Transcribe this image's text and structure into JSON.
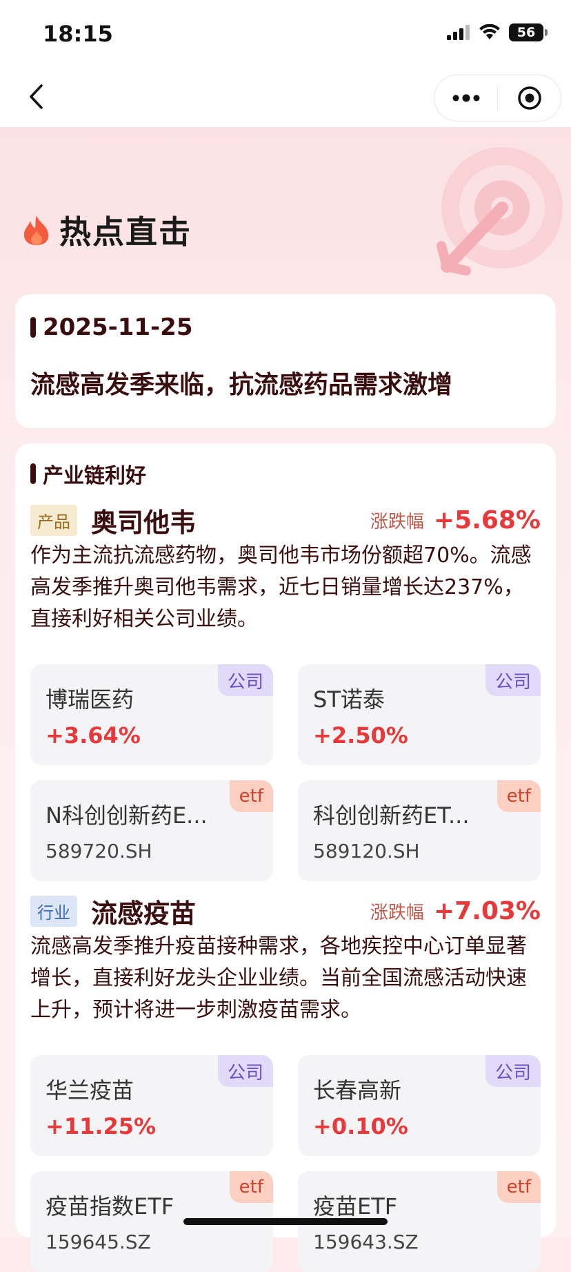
{
  "status": {
    "time": "18:15",
    "battery": "56"
  },
  "nav": {
    "back_icon": "chevron-left-icon",
    "more_icon": "more-dots-icon",
    "close_icon": "target-icon"
  },
  "hero": {
    "title": "热点直击",
    "icon": "flame-icon",
    "deco": "target-arrow-icon"
  },
  "event": {
    "date": "2025-11-25",
    "headline": "流感高发季来临，抗流感药品需求激增"
  },
  "chain": {
    "section_title": "产业链利好",
    "items": [
      {
        "tag": "产品",
        "name": "奥司他韦",
        "change_label": "涨跌幅",
        "change_value": "+5.68%",
        "desc": "作为主流抗流感药物，奥司他韦市场份额超70%。流感高发季推升奥司他韦需求，近七日销量增长达237%，直接利好相关公司业绩。",
        "tiles": [
          {
            "badge": "公司",
            "name": "博瑞医药",
            "value": "+3.64%"
          },
          {
            "badge": "公司",
            "name": "ST诺泰",
            "value": "+2.50%"
          },
          {
            "badge": "etf",
            "name": "N科创创新药E...",
            "code": "589720.SH"
          },
          {
            "badge": "etf",
            "name": "科创创新药ET...",
            "code": "589120.SH"
          }
        ]
      },
      {
        "tag": "行业",
        "name": "流感疫苗",
        "change_label": "涨跌幅",
        "change_value": "+7.03%",
        "desc": "流感高发季推升疫苗接种需求，各地疾控中心订单显著增长，直接利好龙头企业业绩。当前全国流感活动快速上升，预计将进一步刺激疫苗需求。",
        "tiles": [
          {
            "badge": "公司",
            "name": "华兰疫苗",
            "value": "+11.25%"
          },
          {
            "badge": "公司",
            "name": "长春高新",
            "value": "+0.10%"
          },
          {
            "badge": "etf",
            "name": "疫苗指数ETF",
            "code": "159645.SZ"
          },
          {
            "badge": "etf",
            "name": "疫苗ETF",
            "code": "159643.SZ"
          }
        ]
      }
    ]
  },
  "colors": {
    "up": "#e8393a",
    "dark_text": "#3a0e0e",
    "page_bg": "#fdeaec"
  }
}
